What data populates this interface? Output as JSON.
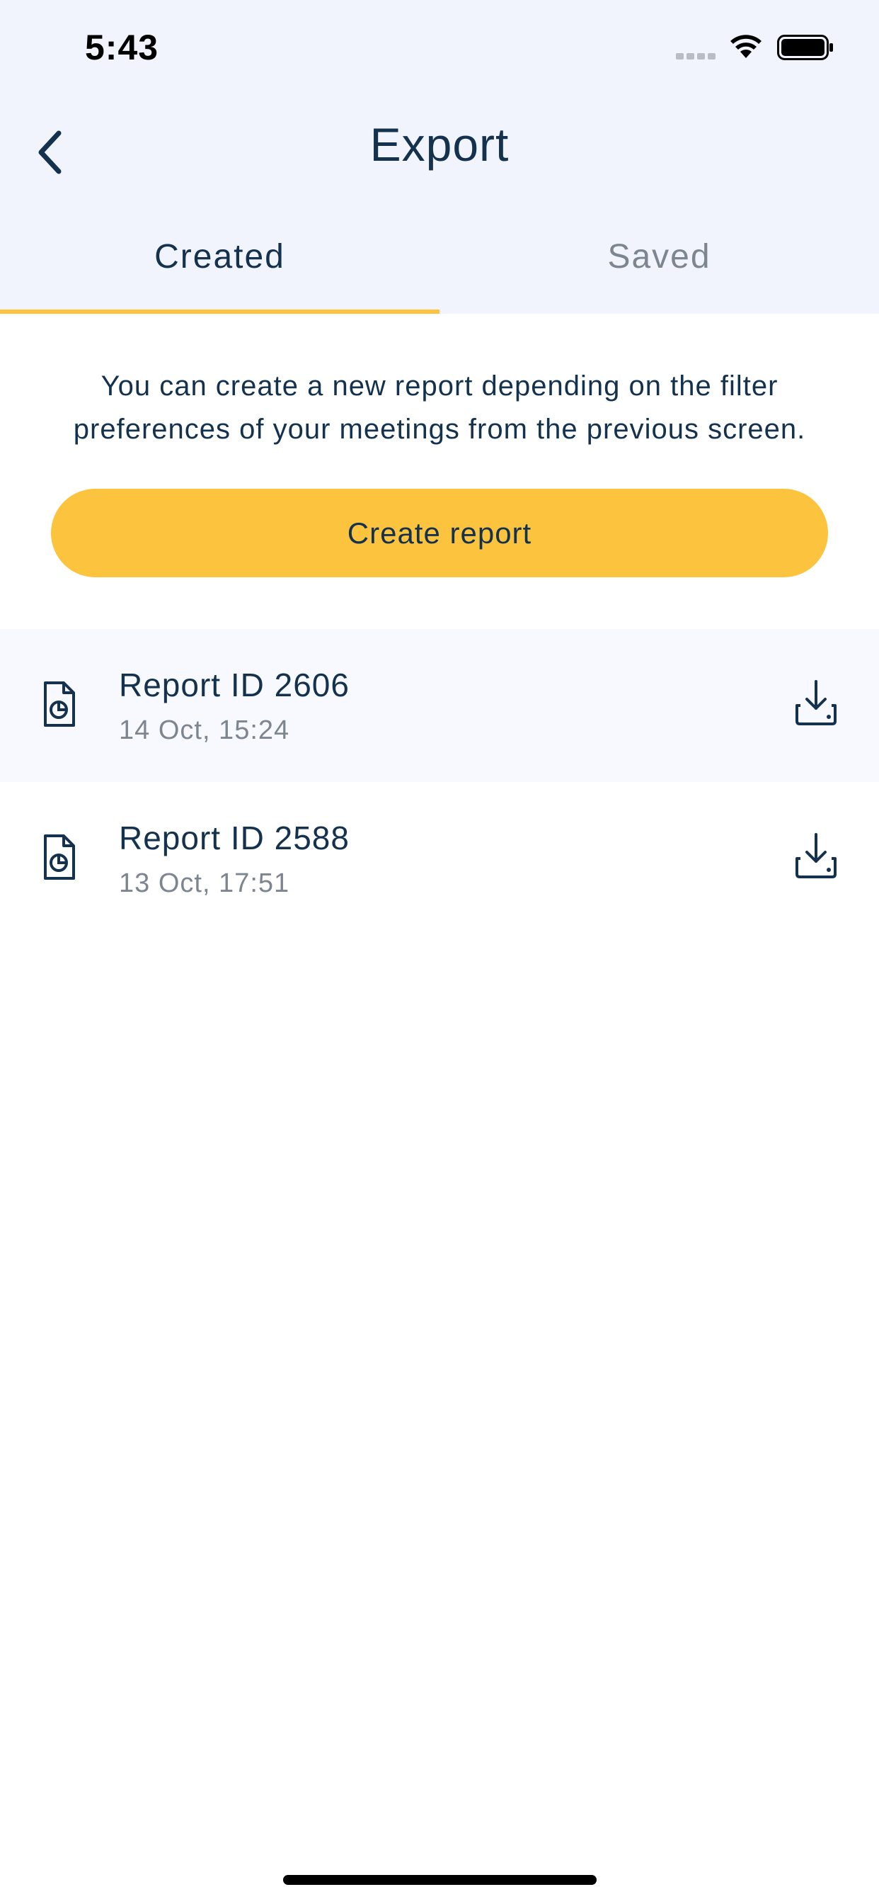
{
  "status_bar": {
    "time": "5:43",
    "icons": [
      "signal-icon",
      "wifi-icon",
      "battery-icon"
    ]
  },
  "header": {
    "title": "Export",
    "back_icon": "chevron-left-icon"
  },
  "tabs": [
    {
      "label": "Created",
      "active": true
    },
    {
      "label": "Saved",
      "active": false
    }
  ],
  "main": {
    "description": "You can create a new report depending on the filter preferences of your meetings from the previous screen.",
    "create_button_label": "Create report"
  },
  "reports": [
    {
      "title": "Report ID 2606",
      "date": "14 Oct, 15:24",
      "icon": "report-file-icon",
      "action_icon": "download-icon"
    },
    {
      "title": "Report ID 2588",
      "date": "13 Oct, 17:51",
      "icon": "report-file-icon",
      "action_icon": "download-icon"
    }
  ],
  "colors": {
    "accent": "#fcc43e",
    "header_bg": "#f1f4fd",
    "text_primary": "#14324e",
    "text_secondary": "#7d8590"
  }
}
